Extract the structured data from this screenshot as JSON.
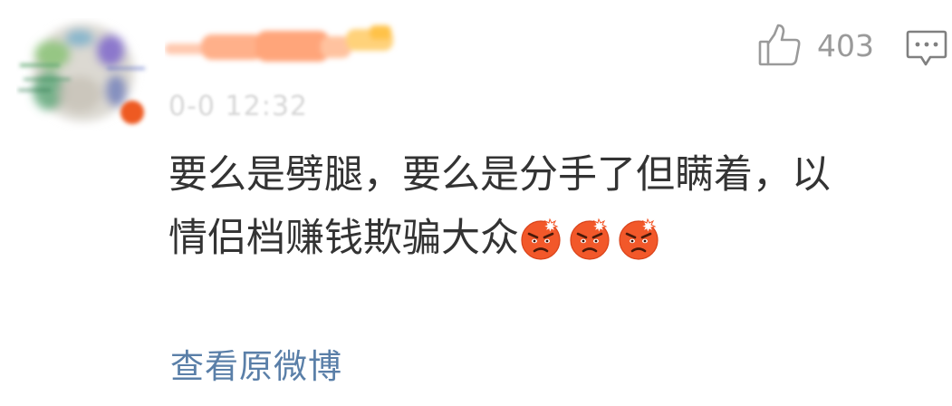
{
  "comment": {
    "timestamp": "0-0 12:32",
    "like_count": "403",
    "text_line1": "要么是劈腿，要么是分手了但瞒着，以",
    "text_line2": "情侣档赚钱欺骗大众",
    "emoji_names": [
      "angry-emoji",
      "angry-emoji",
      "angry-emoji"
    ],
    "view_original_label": "查看原微博"
  },
  "colors": {
    "text": "#333333",
    "meta": "#9a9a9a",
    "link": "#5a7fa8",
    "emoji_face": "#f2582a"
  }
}
